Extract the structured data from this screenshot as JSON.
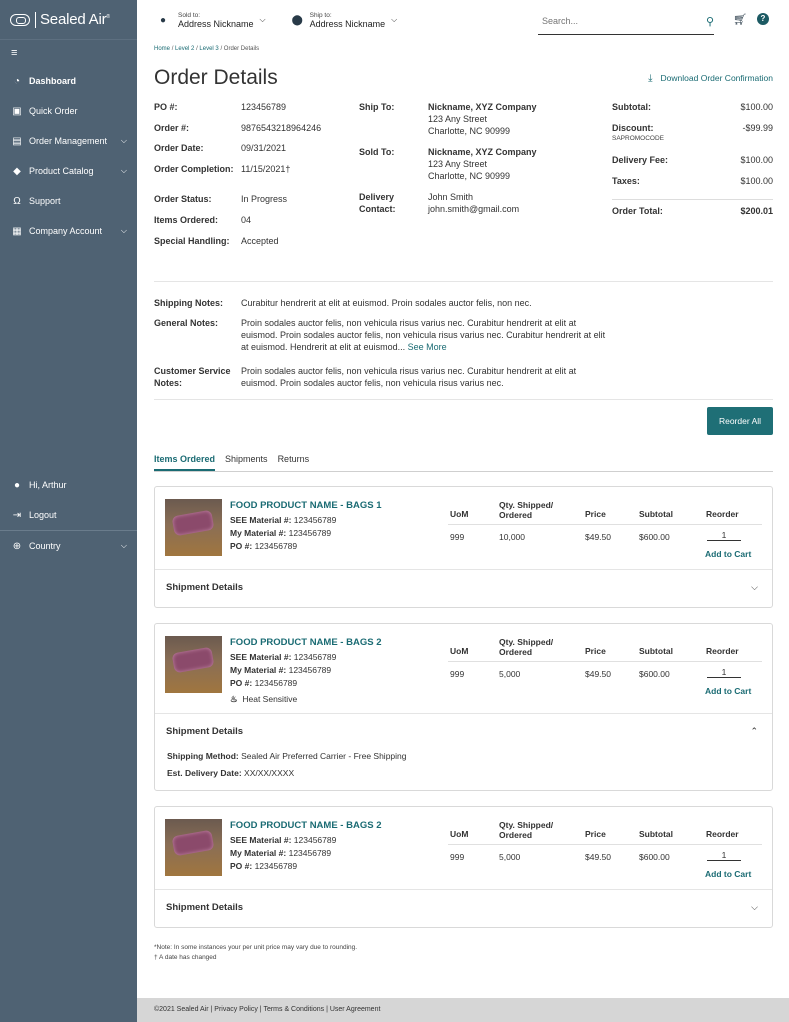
{
  "brand": {
    "name": "Sealed Air",
    "tm": "®"
  },
  "sidebar": {
    "toggle_icon": "menu-icon",
    "items": [
      {
        "label": "Dashboard",
        "icon": "dashboard-icon",
        "active": true
      },
      {
        "label": "Quick Order",
        "icon": "quick-order-icon"
      },
      {
        "label": "Order Management",
        "icon": "order-management-icon",
        "expandable": true
      },
      {
        "label": "Product Catalog",
        "icon": "tag-icon",
        "expandable": true
      },
      {
        "label": "Support",
        "icon": "headset-icon"
      },
      {
        "label": "Company Account",
        "icon": "building-icon",
        "expandable": true
      }
    ],
    "user": {
      "label": "Hi, Arthur",
      "icon": "user-icon"
    },
    "logout": {
      "label": "Logout",
      "icon": "logout-icon"
    },
    "country": {
      "label": "Country",
      "icon": "globe-icon"
    }
  },
  "header": {
    "sold_to": {
      "small": "Sold to:",
      "value": "Address Nickname"
    },
    "ship_to": {
      "small": "Ship to:",
      "value": "Address Nickname"
    },
    "search_placeholder": "Search..."
  },
  "breadcrumb": {
    "home": "Home",
    "level2": "Level 2",
    "level3": "Level 3",
    "current": "Order Details",
    "sep": "/"
  },
  "page": {
    "title": "Order Details",
    "download_label": "Download Order Confirmation"
  },
  "order": {
    "po_label": "PO #:",
    "po": "123456789",
    "order_label": "Order #:",
    "order": "9876543218964246",
    "date_label": "Order Date:",
    "date": "09/31/2021",
    "completion_label": "Order Completion:",
    "completion": "11/15/2021†",
    "status_label": "Order Status:",
    "status": "In Progress",
    "items_label": "Items Ordered:",
    "items": "04",
    "handling_label": "Special Handling:",
    "handling": "Accepted",
    "ship_to_label": "Ship To:",
    "ship_to": {
      "name": "Nickname, XYZ Company",
      "street": "123 Any Street",
      "city": "Charlotte,  NC 90999"
    },
    "sold_to_label": "Sold To:",
    "sold_to": {
      "name": "Nickname, XYZ Company",
      "street": "123 Any Street",
      "city": "Charlotte,  NC 90999"
    },
    "delivery_label_1": "Delivery",
    "delivery_label_2": "Contact:",
    "delivery_name": "John Smith",
    "delivery_email": "john.smith@gmail.com"
  },
  "totals": {
    "subtotal_label": "Subtotal:",
    "subtotal": "$100.00",
    "discount_label": "Discount:",
    "discount": "-$99.99",
    "promo": "SAPROMOCODE",
    "delivery_label": "Delivery Fee:",
    "delivery": "$100.00",
    "taxes_label": "Taxes:",
    "taxes": "$100.00",
    "total_label": "Order Total:",
    "total": "$200.01"
  },
  "notes": {
    "shipping_label": "Shipping Notes:",
    "shipping": "Curabitur hendrerit at elit at euismod. Proin sodales auctor felis, non nec.",
    "general_label": "General Notes:",
    "general": "Proin sodales auctor felis, non vehicula risus varius nec. Curabitur hendrerit at elit at euismod. Proin sodales auctor felis, non vehicula risus varius nec. Curabitur hendrerit at elit at euismod. Hendrerit at elit at euismod...",
    "see_more": "See More",
    "cs_label_1": "Customer Service",
    "cs_label_2": "Notes:",
    "cs": "Proin sodales auctor felis, non vehicula risus varius nec. Curabitur hendrerit at elit at euismod. Proin sodales auctor felis, non vehicula risus varius nec."
  },
  "reorder_all": "Reorder All",
  "tabs": [
    "Items Ordered",
    "Shipments",
    "Returns"
  ],
  "columns": {
    "uom": "UoM",
    "qty_1": "Qty. Shipped/",
    "qty_2": "Ordered",
    "price": "Price",
    "subtotal": "Subtotal",
    "reorder": "Reorder"
  },
  "items": [
    {
      "name": "FOOD PRODUCT NAME - BAGS 1",
      "see_label": "SEE Material #:",
      "see": "123456789",
      "my_label": "My Material #:",
      "my": "123456789",
      "po_label": "PO #:",
      "po": "123456789",
      "uom": "999",
      "qty": "10,000",
      "price": "$49.50",
      "subtotal": "$600.00",
      "reorder_qty": "1",
      "add_to_cart": "Add to Cart",
      "shipment_label": "Shipment Details"
    },
    {
      "name": "FOOD PRODUCT NAME - BAGS 2",
      "see_label": "SEE Material #:",
      "see": "123456789",
      "my_label": "My Material #:",
      "my": "123456789",
      "po_label": "PO #:",
      "po": "123456789",
      "heat": "Heat Sensitive",
      "uom": "999",
      "qty": "5,000",
      "price": "$49.50",
      "subtotal": "$600.00",
      "reorder_qty": "1",
      "add_to_cart": "Add to Cart",
      "shipment_label": "Shipment Details",
      "method_label": "Shipping Method:",
      "method": "Sealed Air Preferred Carrier - Free Shipping",
      "est_label": "Est. Delivery Date:",
      "est": "XX/XX/XXXX"
    },
    {
      "name": "FOOD PRODUCT NAME - BAGS 2",
      "see_label": "SEE Material #:",
      "see": "123456789",
      "my_label": "My Material #:",
      "my": "123456789",
      "po_label": "PO #:",
      "po": "123456789",
      "uom": "999",
      "qty": "5,000",
      "price": "$49.50",
      "subtotal": "$600.00",
      "reorder_qty": "1",
      "add_to_cart": "Add to Cart",
      "shipment_label": "Shipment Details"
    }
  ],
  "footnotes": {
    "note": "*Note: In some instances your per unit price may vary due to rounding.",
    "dagger": "† A date has changed"
  },
  "footer": "©2021 Sealed Air | Privacy Policy | Terms & Conditions | User Agreement"
}
